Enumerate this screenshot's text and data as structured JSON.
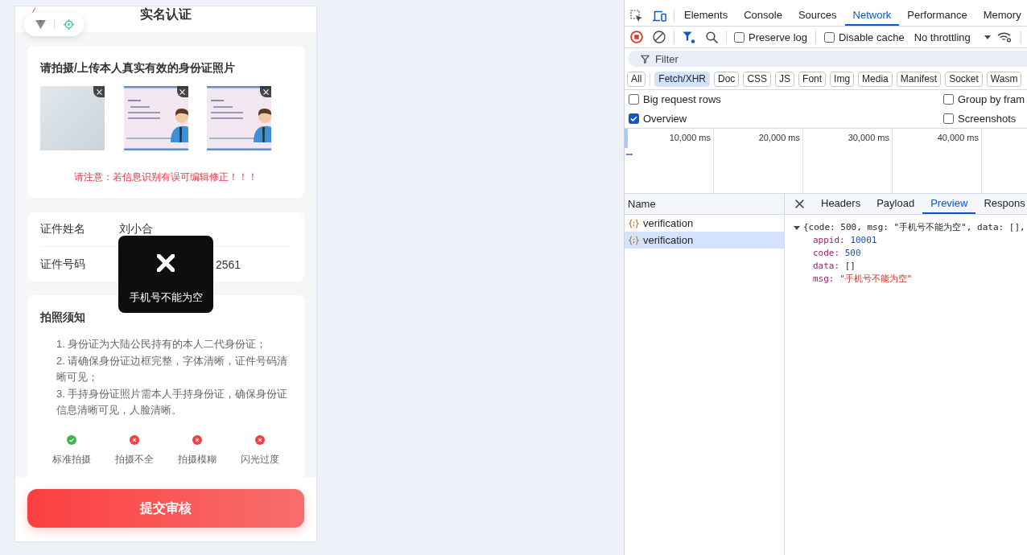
{
  "phone": {
    "title": "实名认证",
    "upload": {
      "title": "请拍摄/上传本人真实有效的身份证照片",
      "photos": [
        {
          "kind": "photo"
        },
        {
          "kind": "illustration"
        },
        {
          "kind": "illustration"
        }
      ],
      "notice": "请注意：若信息识别有误可编辑修正！！！"
    },
    "id_fields": [
      {
        "label": "证件姓名",
        "value": "刘小合",
        "covered": false
      },
      {
        "label": "证件号码",
        "value": "2561",
        "covered": true
      }
    ],
    "guide": {
      "title": "拍照须知",
      "items": [
        "1. 身份证为大陆公民持有的本人二代身份证；",
        "2. 请确保身份证边框完整，字体清晰，证件号码清晰可见；",
        "3. 手持身份证照片需本人手持身份证，确保身份证信息清晰可见，人脸清晰。"
      ],
      "examples": [
        {
          "label": "标准拍摄",
          "ok": true
        },
        {
          "label": "拍摄不全",
          "ok": false
        },
        {
          "label": "拍摄模糊",
          "ok": false
        },
        {
          "label": "闪光过度",
          "ok": false
        }
      ]
    },
    "submit_button": "提交审核",
    "toast": {
      "message": "手机号不能为空"
    }
  },
  "devtools": {
    "device_mode": true,
    "tabs": [
      {
        "label": "Elements",
        "selected": false
      },
      {
        "label": "Console",
        "selected": false
      },
      {
        "label": "Sources",
        "selected": false
      },
      {
        "label": "Network",
        "selected": true
      },
      {
        "label": "Performance",
        "selected": false
      },
      {
        "label": "Memory",
        "selected": false
      }
    ],
    "toolbar": {
      "recording": true,
      "checkboxes": [
        {
          "label": "Preserve log",
          "checked": false
        },
        {
          "label": "Disable cache",
          "checked": false
        }
      ],
      "throttling": "No throttling"
    },
    "filter": {
      "placeholder": "Filter"
    },
    "type_filters": [
      {
        "label": "All",
        "selected": false
      },
      {
        "label": "Fetch/XHR",
        "selected": true
      },
      {
        "label": "Doc",
        "selected": false
      },
      {
        "label": "CSS",
        "selected": false
      },
      {
        "label": "JS",
        "selected": false
      },
      {
        "label": "Font",
        "selected": false
      },
      {
        "label": "Img",
        "selected": false
      },
      {
        "label": "Media",
        "selected": false
      },
      {
        "label": "Manifest",
        "selected": false
      },
      {
        "label": "Socket",
        "selected": false
      },
      {
        "label": "Wasm",
        "selected": false
      }
    ],
    "options": [
      {
        "label": "Big request rows",
        "checked": false
      },
      {
        "label": "Group by fram",
        "checked": false
      },
      {
        "label": "Overview",
        "checked": true
      },
      {
        "label": "Screenshots",
        "checked": false
      }
    ],
    "overview": {
      "ticks": [
        "10,000 ms",
        "20,000 ms",
        "30,000 ms",
        "40,000 ms"
      ]
    },
    "requests": {
      "column": "Name",
      "rows": [
        {
          "name": "verification",
          "selected": false
        },
        {
          "name": "verification",
          "selected": true
        }
      ]
    },
    "detail": {
      "tabs": [
        {
          "label": "Headers",
          "selected": false
        },
        {
          "label": "Payload",
          "selected": false
        },
        {
          "label": "Preview",
          "selected": true
        },
        {
          "label": "Respons",
          "selected": false
        }
      ],
      "preview": {
        "expanded": true,
        "summary": "{code: 500, msg: \"手机号不能为空\", data: [],",
        "fields": [
          {
            "key": "appid:",
            "value": "10001",
            "kind": "number"
          },
          {
            "key": "code:",
            "value": "500",
            "kind": "number"
          },
          {
            "key": "data:",
            "value": "[]",
            "kind": "array"
          },
          {
            "key": "msg:",
            "value": "\"手机号不能为空\"",
            "kind": "string"
          }
        ]
      }
    }
  }
}
